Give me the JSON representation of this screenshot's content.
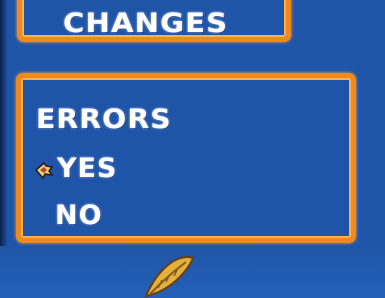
{
  "screen": {
    "title": "CHANGES",
    "menu": {
      "heading": "ERRORS",
      "options": [
        {
          "label": "YES",
          "selected": true
        },
        {
          "label": "NO",
          "selected": false
        }
      ]
    },
    "cursor_icon": "hand-cursor-icon",
    "sprite_icon": "leaf-sprite-icon"
  },
  "colors": {
    "background": "#1f55a8",
    "frame": "#f08a1e",
    "text": "#ffffff"
  }
}
